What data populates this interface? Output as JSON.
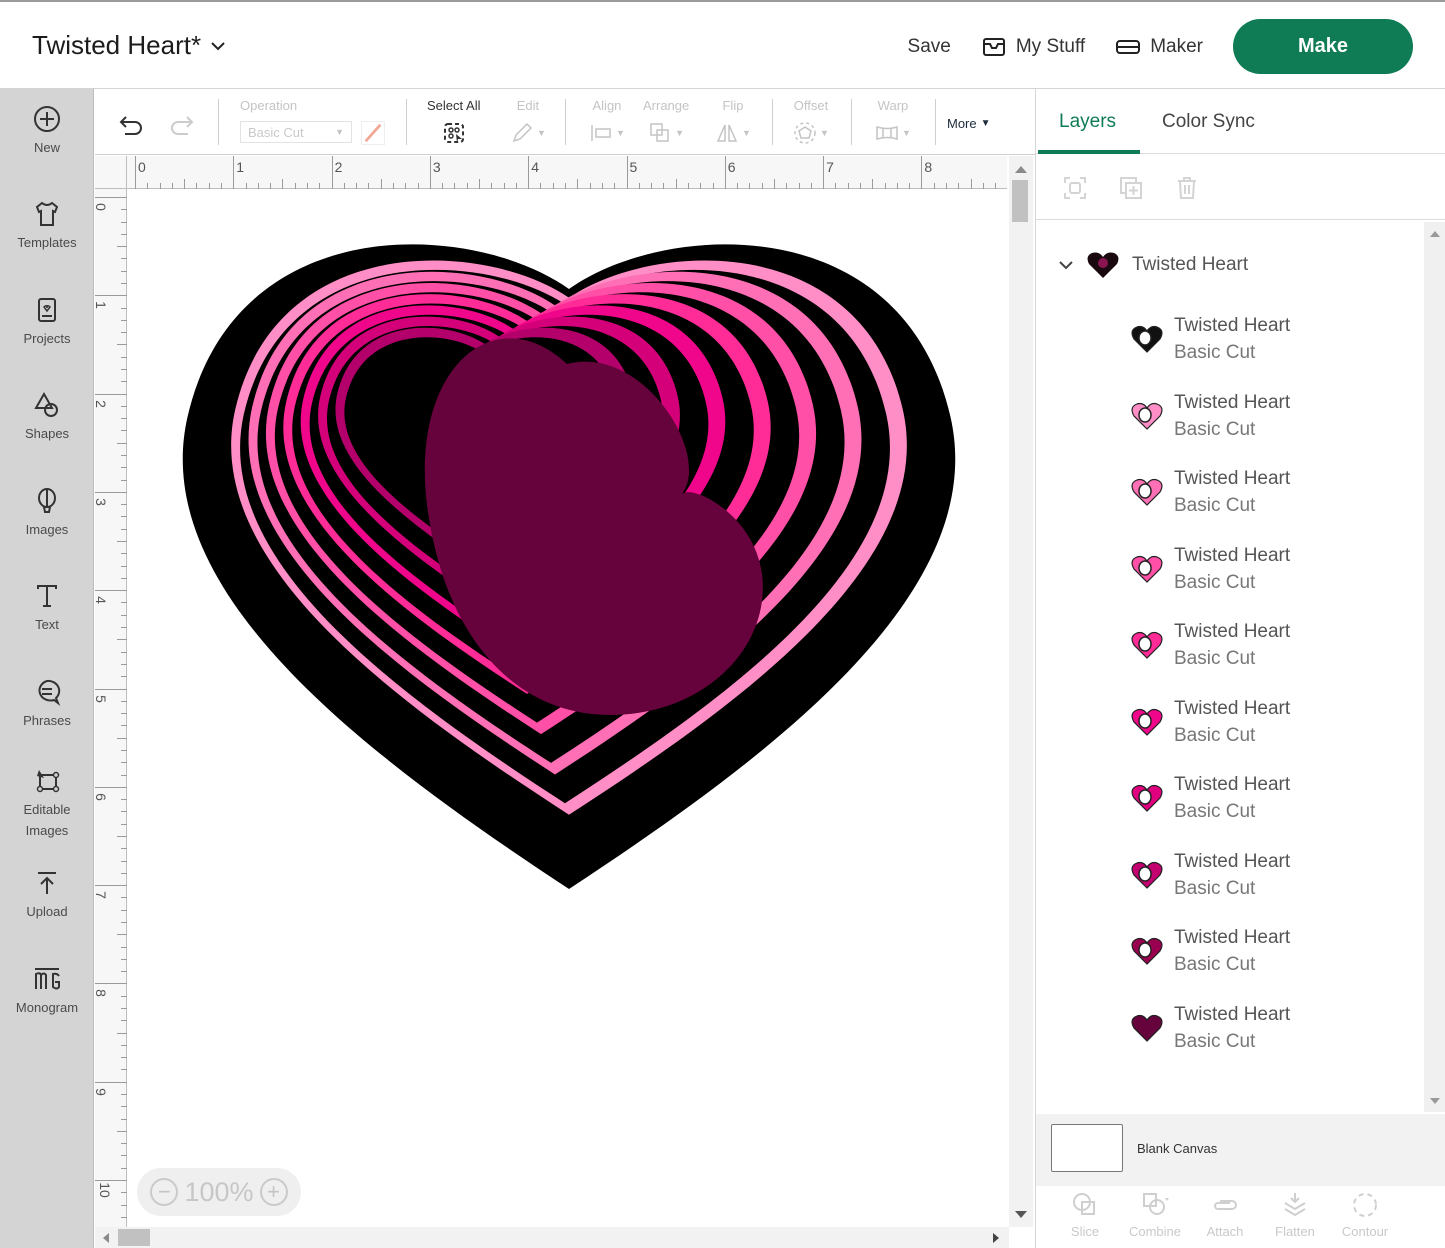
{
  "header": {
    "project_title": "Twisted Heart*",
    "save_label": "Save",
    "my_stuff_label": "My Stuff",
    "maker_label": "Maker",
    "make_label": "Make"
  },
  "sidebar": {
    "items": [
      {
        "label": "New",
        "icon": "plus-circle-icon"
      },
      {
        "label": "Templates",
        "icon": "tshirt-icon"
      },
      {
        "label": "Projects",
        "icon": "project-card-icon"
      },
      {
        "label": "Shapes",
        "icon": "shapes-icon"
      },
      {
        "label": "Images",
        "icon": "balloon-icon"
      },
      {
        "label": "Text",
        "icon": "text-icon"
      },
      {
        "label": "Phrases",
        "icon": "speech-bubble-icon"
      },
      {
        "label": "Editable\nImages",
        "label_line1": "Editable",
        "label_line2": "Images",
        "icon": "editable-image-icon"
      },
      {
        "label": "Upload",
        "icon": "upload-icon"
      },
      {
        "label": "Monogram",
        "icon": "monogram-icon"
      }
    ]
  },
  "toolbar": {
    "operation_label": "Operation",
    "operation_value": "Basic Cut",
    "select_all_label": "Select All",
    "edit_label": "Edit",
    "align_label": "Align",
    "arrange_label": "Arrange",
    "flip_label": "Flip",
    "offset_label": "Offset",
    "warp_label": "Warp",
    "more_label": "More"
  },
  "rulers": {
    "top": [
      "0",
      "1",
      "2",
      "3",
      "4",
      "5",
      "6",
      "7",
      "8"
    ],
    "left": [
      "0",
      "1",
      "2",
      "3",
      "4",
      "5",
      "6",
      "7",
      "8",
      "9",
      "10"
    ]
  },
  "canvas": {
    "zoom_level": "100%",
    "colors": {
      "outline": "#000000",
      "inner": "#66023c",
      "stripes": [
        "#ff8ec7",
        "#ff6fb6",
        "#ff4fa6",
        "#ff2b97",
        "#f0068a",
        "#d4007a",
        "#b3006a"
      ]
    }
  },
  "layers_panel": {
    "tabs": [
      "Layers",
      "Color Sync"
    ],
    "active_tab": "Layers",
    "group_name": "Twisted Heart",
    "layers": [
      {
        "name": "Twisted Heart",
        "operation": "Basic Cut",
        "color": "#111111"
      },
      {
        "name": "Twisted Heart",
        "operation": "Basic Cut",
        "color": "#ff8ec7"
      },
      {
        "name": "Twisted Heart",
        "operation": "Basic Cut",
        "color": "#ff6fb6"
      },
      {
        "name": "Twisted Heart",
        "operation": "Basic Cut",
        "color": "#ff4fa6"
      },
      {
        "name": "Twisted Heart",
        "operation": "Basic Cut",
        "color": "#ff2b97"
      },
      {
        "name": "Twisted Heart",
        "operation": "Basic Cut",
        "color": "#f0068a"
      },
      {
        "name": "Twisted Heart",
        "operation": "Basic Cut",
        "color": "#e0007f"
      },
      {
        "name": "Twisted Heart",
        "operation": "Basic Cut",
        "color": "#c40070"
      },
      {
        "name": "Twisted Heart",
        "operation": "Basic Cut",
        "color": "#99004f"
      },
      {
        "name": "Twisted Heart",
        "operation": "Basic Cut",
        "color": "#66023c"
      }
    ],
    "blank_canvas_label": "Blank Canvas",
    "bottom_tools": [
      "Slice",
      "Combine",
      "Attach",
      "Flatten",
      "Contour"
    ]
  },
  "accent_color": "#0f7c55"
}
